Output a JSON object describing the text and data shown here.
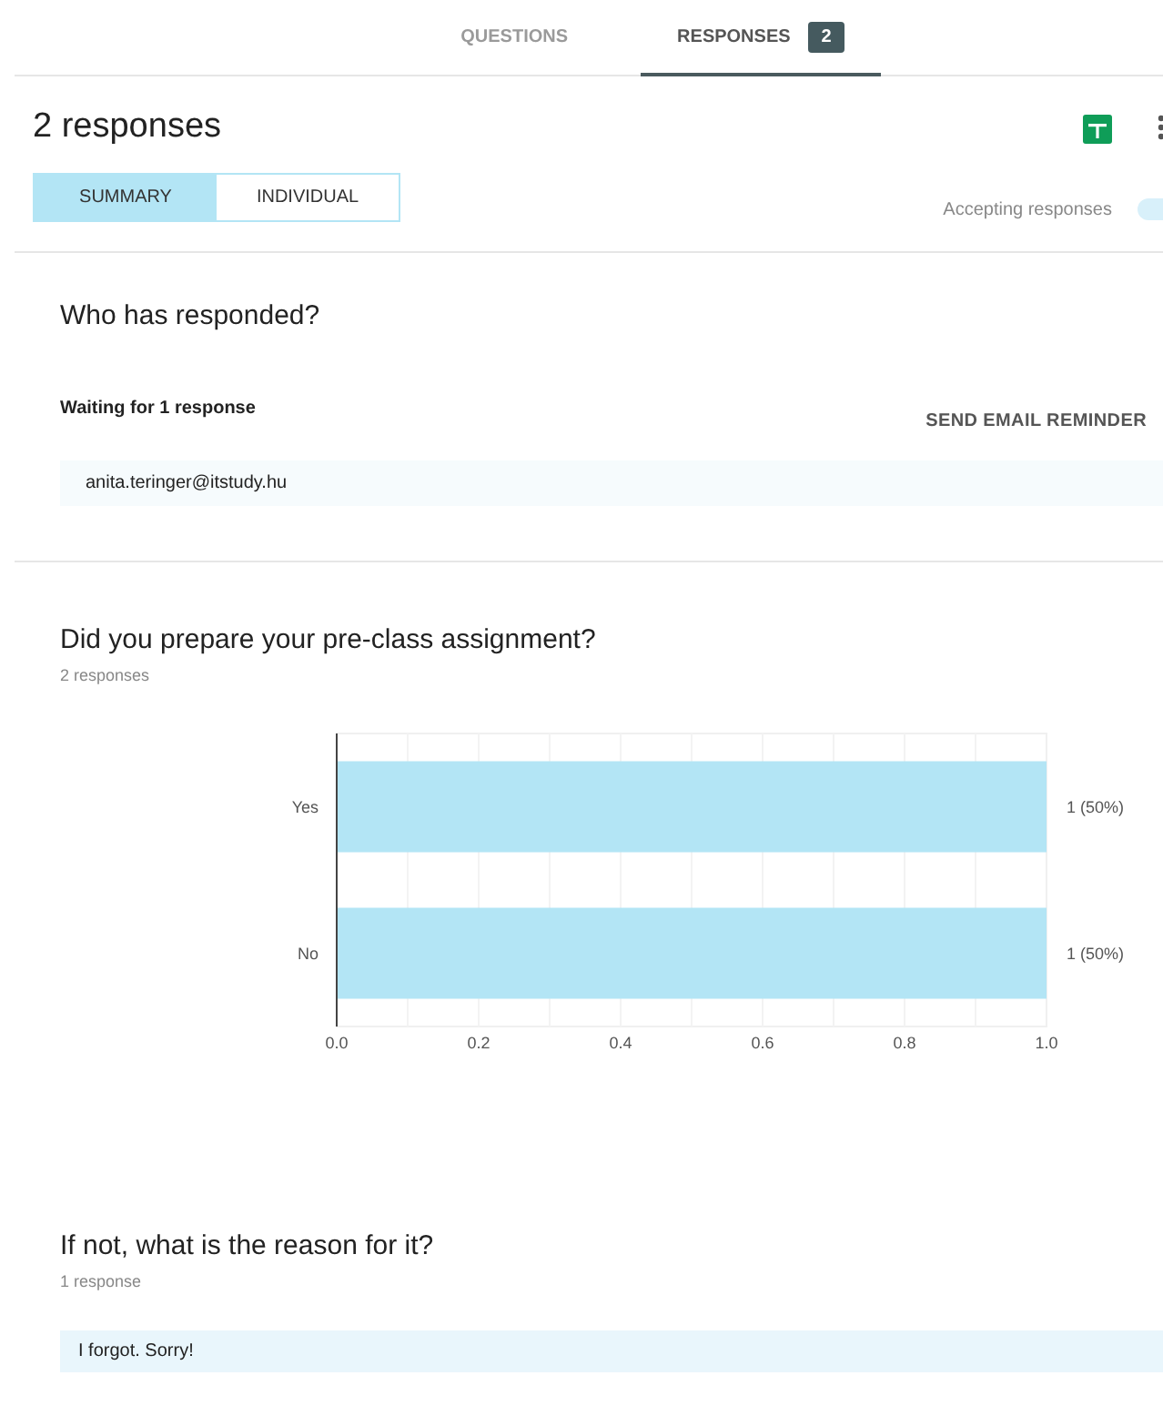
{
  "tabs": [
    {
      "label": "QUESTIONS",
      "selected": false
    },
    {
      "label": "RESPONSES",
      "selected": true,
      "badge": "2"
    }
  ],
  "header": {
    "title": "2 responses",
    "views": [
      {
        "label": "SUMMARY",
        "selected": true
      },
      {
        "label": "INDIVIDUAL",
        "selected": false
      }
    ],
    "accepting": {
      "label": "Accepting responses",
      "on": true
    }
  },
  "respondents": {
    "title": "Who has responded?",
    "waiting": "Waiting for 1 response",
    "action": "SEND EMAIL REMINDER",
    "emails": [
      "anita.teringer@itstudy.hu"
    ]
  },
  "questions": [
    {
      "kind": "chart",
      "title": "Did you prepare your pre-class assignment?",
      "count": "2 responses",
      "chart_data": {
        "type": "bar",
        "orientation": "horizontal",
        "categories": [
          "Yes",
          "No"
        ],
        "series": [
          {
            "color": "#b3e5f5",
            "values": [
              1,
              1
            ]
          }
        ],
        "grid": true,
        "xlim": [
          0,
          1
        ],
        "xticks": [
          {
            "value": 0,
            "label": "0.0"
          },
          {
            "value": 0.2,
            "label": "0.2"
          },
          {
            "value": 0.4,
            "label": "0.4"
          },
          {
            "value": 0.6,
            "label": "0.6"
          },
          {
            "value": 0.8,
            "label": "0.8"
          },
          {
            "value": 1,
            "label": "1.0"
          }
        ],
        "value_labels": [
          "1 (50%)",
          "1 (50%)"
        ]
      }
    },
    {
      "kind": "text",
      "title": "If not, what is the reason for it?",
      "count": "1 response",
      "answers": [
        "I forgot. Sorry!"
      ]
    }
  ]
}
